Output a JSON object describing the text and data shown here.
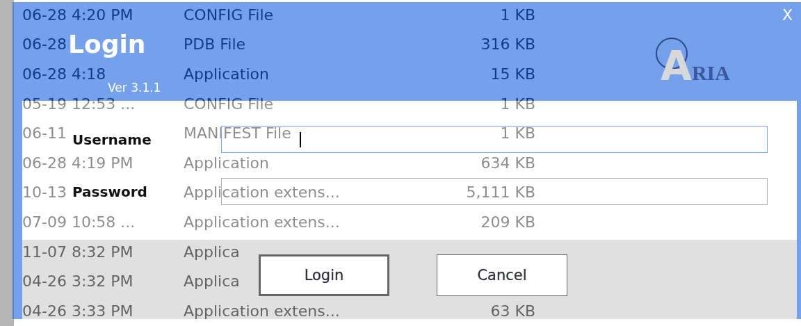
{
  "background_files": [
    {
      "date": "06-28 4:20 PM",
      "type": "CONFIG File",
      "size": "1 KB"
    },
    {
      "date": "06-28",
      "type": "PDB File",
      "size": "316 KB"
    },
    {
      "date": "06-28 4:18",
      "type": "Application",
      "size": "15 KB"
    },
    {
      "date": "05-19 12:53 ...",
      "type": "CONFIG File",
      "size": "1 KB"
    },
    {
      "date": "06-11",
      "type": "MANIFEST File",
      "size": "1 KB"
    },
    {
      "date": "06-28 4:19 PM",
      "type": "Application",
      "size": "634 KB"
    },
    {
      "date": "10-13",
      "type": "Application extens...",
      "size": "5,111 KB"
    },
    {
      "date": "07-09 10:58 ...",
      "type": "Application extens...",
      "size": "209 KB"
    },
    {
      "date": "11-07 8:32 PM",
      "type": "Applica"
    },
    {
      "date": "04-26 3:32 PM",
      "type": "Applica"
    },
    {
      "date": "04-26 3:33 PM",
      "type": "Application extens...",
      "size": "63 KB"
    }
  ],
  "dialog": {
    "title": "Login",
    "version": "Ver 3.1.1",
    "close": "X",
    "logo": {
      "initial": "A",
      "rest": "RIA"
    },
    "fields": [
      {
        "label": "Username",
        "focused": true
      },
      {
        "label": "Password",
        "focused": false
      }
    ],
    "buttons": [
      {
        "label": "Login",
        "default": true
      },
      {
        "label": "Cancel",
        "default": false
      }
    ]
  }
}
